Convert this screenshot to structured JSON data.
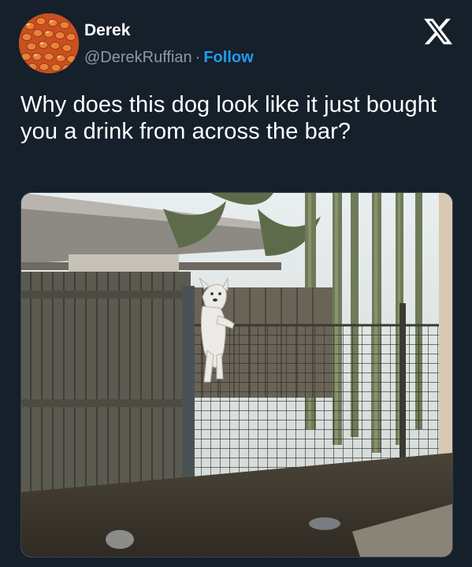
{
  "tweet": {
    "author": {
      "display_name": "Derek",
      "handle": "@DerekRuffian",
      "separator": "·",
      "follow_label": "Follow",
      "avatar_icon": "baked-beans-avatar"
    },
    "brand_icon": "x-logo-icon",
    "text": "Why does this dog look like it just bought you a drink from across the bar?",
    "media": {
      "type": "photo",
      "icon": "photo-dog-on-fence"
    }
  },
  "colors": {
    "background": "#15202b",
    "primary_text": "#ffffff",
    "secondary_text": "#8b98a5",
    "accent": "#1d9bf0",
    "border": "#38444d"
  }
}
